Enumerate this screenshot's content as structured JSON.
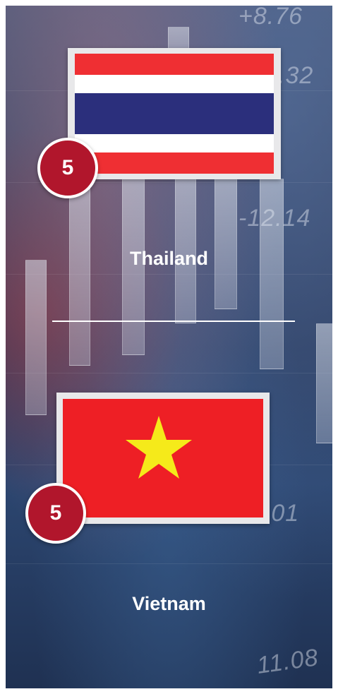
{
  "colors": {
    "badge": "#b1162c",
    "thailand_red": "#ef2f33",
    "thailand_white": "#ffffff",
    "thailand_blue": "#2b2f7c",
    "vietnam_red": "#ee1f25",
    "vietnam_star": "#f5ea1a"
  },
  "background": {
    "tickers": [
      "+8.76",
      ".32",
      "-12.14",
      "5.01",
      "11.08"
    ]
  },
  "entries": [
    {
      "country": "Thailand",
      "rank": "5",
      "flag": "thailand-flag-icon"
    },
    {
      "country": "Vietnam",
      "rank": "5",
      "flag": "vietnam-flag-icon"
    }
  ]
}
